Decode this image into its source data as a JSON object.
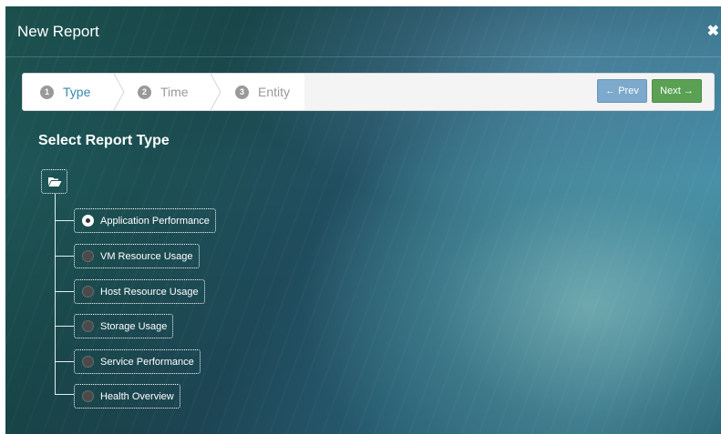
{
  "modal": {
    "title": "New Report",
    "close_icon": "✖"
  },
  "wizard": {
    "steps": [
      {
        "number": "1",
        "label": "Type",
        "active": true
      },
      {
        "number": "2",
        "label": "Time",
        "active": false
      },
      {
        "number": "3",
        "label": "Entity",
        "active": false
      }
    ],
    "prev_label": "← Prev",
    "next_label": "Next →"
  },
  "content": {
    "section_title": "Select Report Type",
    "folder_icon": "folder-open-icon",
    "options": [
      {
        "label": "Application Performance",
        "selected": true
      },
      {
        "label": "VM Resource Usage",
        "selected": false
      },
      {
        "label": "Host Resource Usage",
        "selected": false
      },
      {
        "label": "Storage Usage",
        "selected": false
      },
      {
        "label": "Service Performance",
        "selected": false
      },
      {
        "label": "Health Overview",
        "selected": false
      }
    ]
  },
  "colors": {
    "active_step": "#3a87ad",
    "inactive_step": "#999999",
    "prev_button": "#7da9cc",
    "next_button": "#5aa154"
  }
}
